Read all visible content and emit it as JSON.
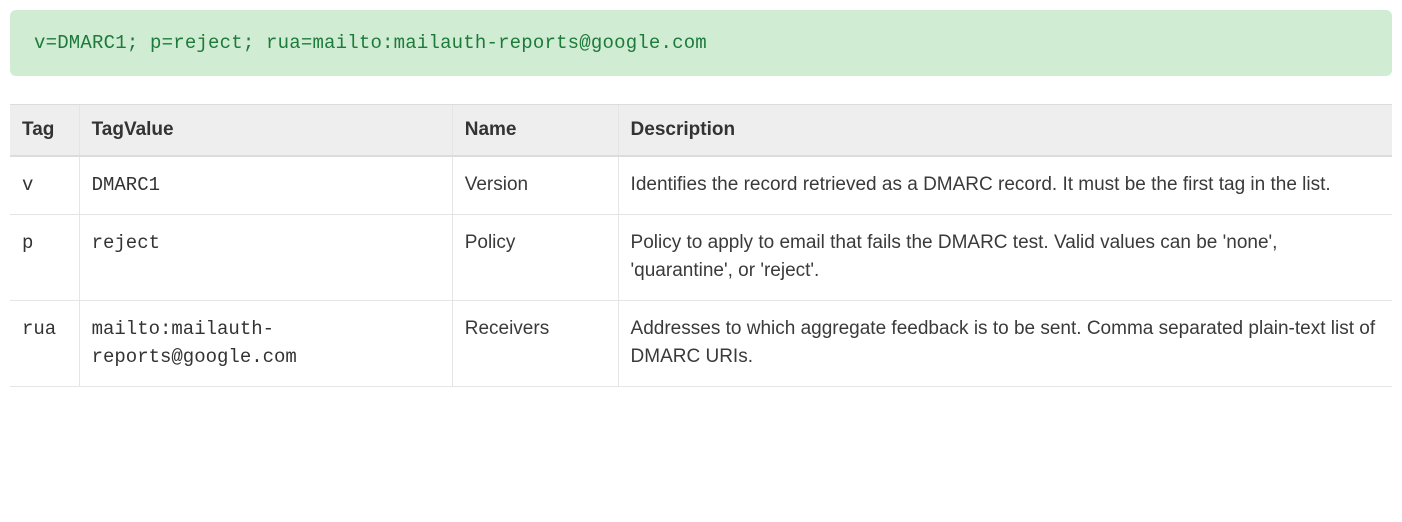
{
  "banner": {
    "text": "v=DMARC1; p=reject; rua=mailto:mailauth-reports@google.com"
  },
  "table": {
    "headers": {
      "tag": "Tag",
      "tagvalue": "TagValue",
      "name": "Name",
      "description": "Description"
    },
    "rows": [
      {
        "tag": "v",
        "tagvalue": "DMARC1",
        "name": "Version",
        "description": "Identifies the record retrieved as a DMARC record. It must be the first tag in the list."
      },
      {
        "tag": "p",
        "tagvalue": "reject",
        "name": "Policy",
        "description": "Policy to apply to email that fails the DMARC test. Valid values can be 'none', 'quarantine', or 'reject'."
      },
      {
        "tag": "rua",
        "tagvalue": "mailto:mailauth-reports@google.com",
        "name": "Receivers",
        "description": "Addresses to which aggregate feedback is to be sent. Comma separated plain-text list of DMARC URIs."
      }
    ]
  }
}
